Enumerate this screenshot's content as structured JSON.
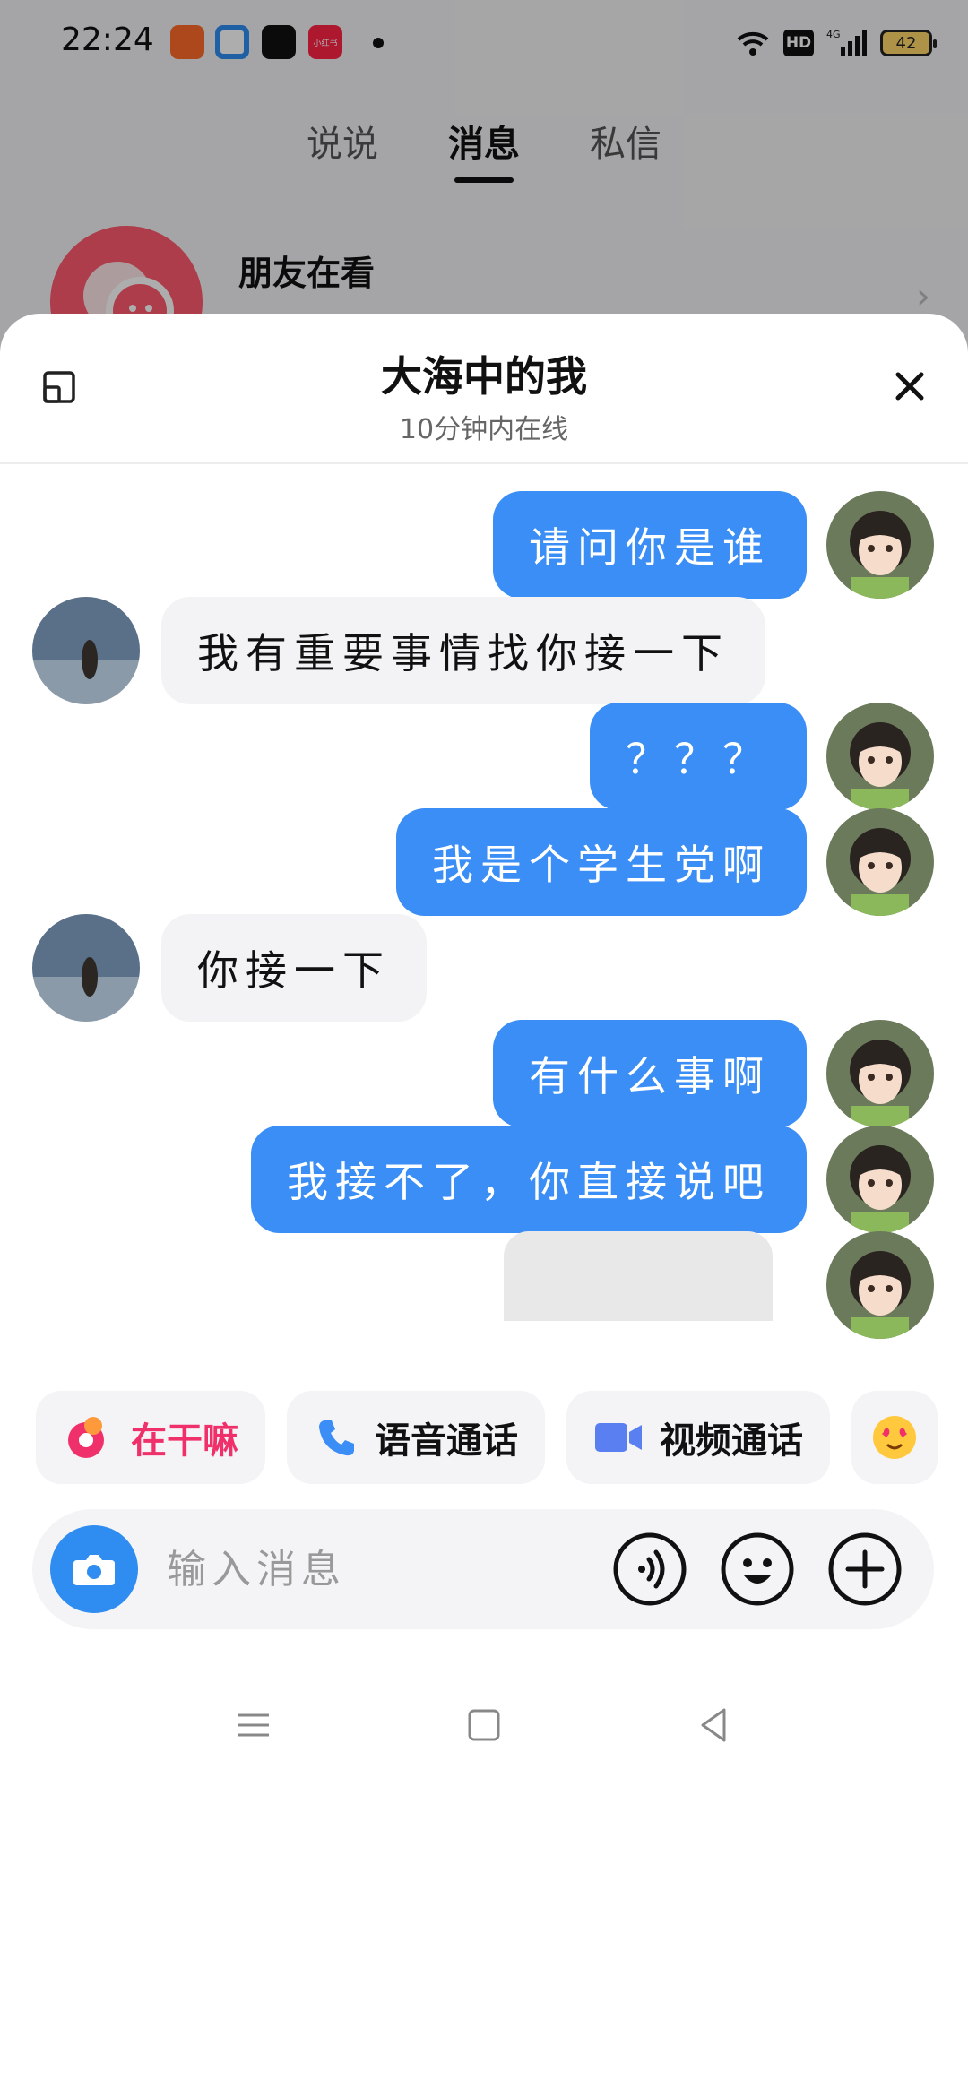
{
  "status_bar": {
    "time": "22:24",
    "battery": "42",
    "app_icons": [
      "kuaishou-icon",
      "browser-icon",
      "douyin-icon",
      "xiaohongshu-icon"
    ],
    "app_icon_labels": {
      "xiaohongshu": "小红书"
    }
  },
  "top_tabs": [
    {
      "label": "说说",
      "active": false
    },
    {
      "label": "消息",
      "active": true
    },
    {
      "label": "私信",
      "active": false
    }
  ],
  "friends_row": {
    "title": "朋友在看"
  },
  "chat": {
    "name": "大海中的我",
    "status": "10分钟内在线",
    "messages": [
      {
        "from": "me",
        "text": "请问你是谁"
      },
      {
        "from": "them",
        "text": "我有重要事情找你接一下"
      },
      {
        "from": "me",
        "text": "？？？"
      },
      {
        "from": "me",
        "text": "我是个学生党啊"
      },
      {
        "from": "them",
        "text": "你接一下"
      },
      {
        "from": "me",
        "text": "有什么事啊"
      },
      {
        "from": "me",
        "text": "我接不了，你直接说吧"
      },
      {
        "from": "me",
        "text": ""
      }
    ]
  },
  "quick_actions": [
    {
      "label": "在干嘛",
      "icon": "busy-icon"
    },
    {
      "label": "语音通话",
      "icon": "phone-icon"
    },
    {
      "label": "视频通话",
      "icon": "video-icon"
    },
    {
      "label": "",
      "icon": "emoji-love-icon"
    }
  ],
  "input": {
    "placeholder": "输入消息"
  },
  "colors": {
    "accent": "#3a8ef5",
    "busy": "#f0306a"
  }
}
